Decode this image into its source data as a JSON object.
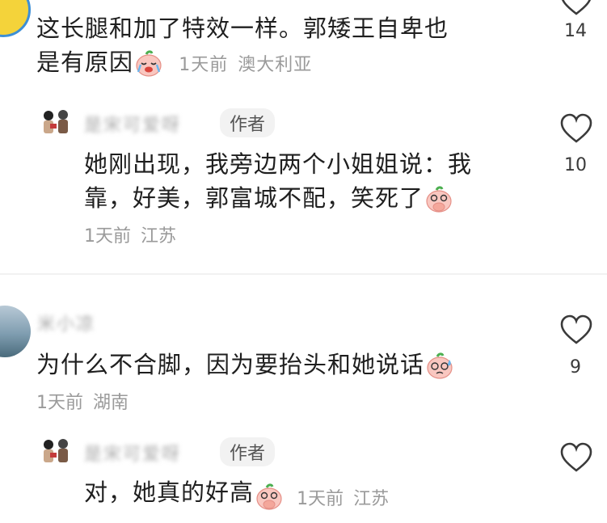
{
  "comments": [
    {
      "text_line1": "这长腿和加了特效一样。郭矮王自卑也",
      "text_line2": "是有原因",
      "time": "1天前",
      "location": "澳大利亚",
      "likes": "14"
    },
    {
      "username": "是宋可爱呀",
      "badge": "作者",
      "text_line1": "她刚出现，我旁边两个小姐姐说：我",
      "text_line2": "靠，好美，郭富城不配，笑死了",
      "time": "1天前",
      "location": "江苏",
      "likes": "10"
    },
    {
      "username": "米小凉",
      "text_line1": "为什么不合脚，因为要抬头和她说话",
      "time": "1天前",
      "location": "湖南",
      "likes": "9"
    },
    {
      "username": "是宋可爱呀",
      "badge": "作者",
      "text_line1": "对，她真的好高",
      "time": "1天前",
      "location": "江苏"
    }
  ],
  "icons": {
    "heart": "heart-icon",
    "crying_emoji": "crying-emoji-icon",
    "laugh_emoji": "covering-mouth-emoji-icon",
    "sweat_emoji": "sweat-emoji-icon"
  }
}
